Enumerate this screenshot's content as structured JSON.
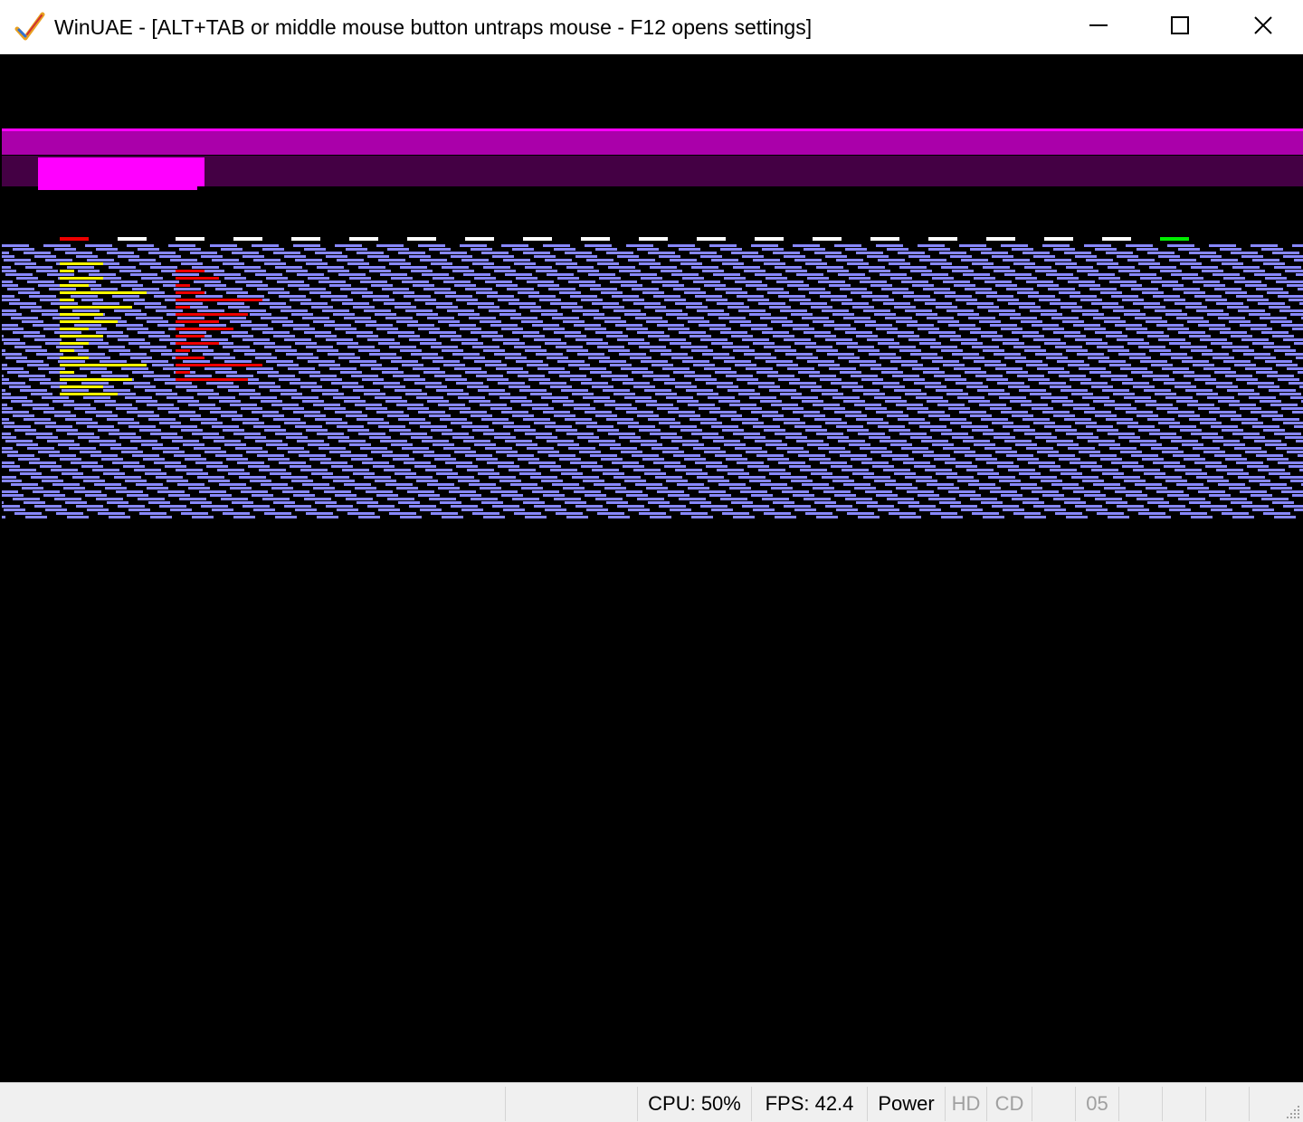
{
  "window": {
    "title": "WinUAE - [ALT+TAB or middle mouse button untraps mouse - F12 opens settings]",
    "icon": "winuae-checkmark-icon",
    "controls": {
      "minimize": "minimize-icon",
      "maximize": "maximize-icon",
      "close": "close-icon"
    }
  },
  "display": {
    "background": "#000000",
    "colors": {
      "magenta_bright": "#ff00ff",
      "magenta_mid": "#aa00aa",
      "magenta_dark": "#440044",
      "brick": "#8888ff",
      "yellow": "#ffff00",
      "red": "#ee0000",
      "white": "#ffffff",
      "green": "#00ee00"
    }
  },
  "statusbar": {
    "cpu": "CPU: 50%",
    "fps": "FPS: 42.4",
    "power": "Power",
    "hd": "HD",
    "cd": "CD",
    "drive": "05"
  }
}
